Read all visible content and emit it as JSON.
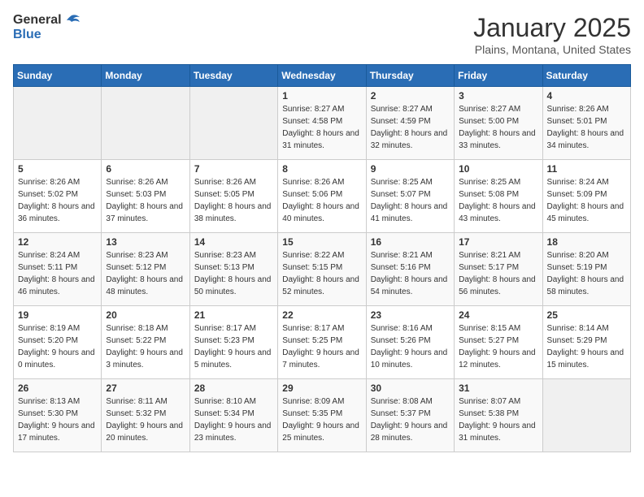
{
  "logo": {
    "general": "General",
    "blue": "Blue"
  },
  "header": {
    "month": "January 2025",
    "location": "Plains, Montana, United States"
  },
  "weekdays": [
    "Sunday",
    "Monday",
    "Tuesday",
    "Wednesday",
    "Thursday",
    "Friday",
    "Saturday"
  ],
  "weeks": [
    [
      {
        "day": "",
        "sunrise": "",
        "sunset": "",
        "daylight": ""
      },
      {
        "day": "",
        "sunrise": "",
        "sunset": "",
        "daylight": ""
      },
      {
        "day": "",
        "sunrise": "",
        "sunset": "",
        "daylight": ""
      },
      {
        "day": "1",
        "sunrise": "Sunrise: 8:27 AM",
        "sunset": "Sunset: 4:58 PM",
        "daylight": "Daylight: 8 hours and 31 minutes."
      },
      {
        "day": "2",
        "sunrise": "Sunrise: 8:27 AM",
        "sunset": "Sunset: 4:59 PM",
        "daylight": "Daylight: 8 hours and 32 minutes."
      },
      {
        "day": "3",
        "sunrise": "Sunrise: 8:27 AM",
        "sunset": "Sunset: 5:00 PM",
        "daylight": "Daylight: 8 hours and 33 minutes."
      },
      {
        "day": "4",
        "sunrise": "Sunrise: 8:26 AM",
        "sunset": "Sunset: 5:01 PM",
        "daylight": "Daylight: 8 hours and 34 minutes."
      }
    ],
    [
      {
        "day": "5",
        "sunrise": "Sunrise: 8:26 AM",
        "sunset": "Sunset: 5:02 PM",
        "daylight": "Daylight: 8 hours and 36 minutes."
      },
      {
        "day": "6",
        "sunrise": "Sunrise: 8:26 AM",
        "sunset": "Sunset: 5:03 PM",
        "daylight": "Daylight: 8 hours and 37 minutes."
      },
      {
        "day": "7",
        "sunrise": "Sunrise: 8:26 AM",
        "sunset": "Sunset: 5:05 PM",
        "daylight": "Daylight: 8 hours and 38 minutes."
      },
      {
        "day": "8",
        "sunrise": "Sunrise: 8:26 AM",
        "sunset": "Sunset: 5:06 PM",
        "daylight": "Daylight: 8 hours and 40 minutes."
      },
      {
        "day": "9",
        "sunrise": "Sunrise: 8:25 AM",
        "sunset": "Sunset: 5:07 PM",
        "daylight": "Daylight: 8 hours and 41 minutes."
      },
      {
        "day": "10",
        "sunrise": "Sunrise: 8:25 AM",
        "sunset": "Sunset: 5:08 PM",
        "daylight": "Daylight: 8 hours and 43 minutes."
      },
      {
        "day": "11",
        "sunrise": "Sunrise: 8:24 AM",
        "sunset": "Sunset: 5:09 PM",
        "daylight": "Daylight: 8 hours and 45 minutes."
      }
    ],
    [
      {
        "day": "12",
        "sunrise": "Sunrise: 8:24 AM",
        "sunset": "Sunset: 5:11 PM",
        "daylight": "Daylight: 8 hours and 46 minutes."
      },
      {
        "day": "13",
        "sunrise": "Sunrise: 8:23 AM",
        "sunset": "Sunset: 5:12 PM",
        "daylight": "Daylight: 8 hours and 48 minutes."
      },
      {
        "day": "14",
        "sunrise": "Sunrise: 8:23 AM",
        "sunset": "Sunset: 5:13 PM",
        "daylight": "Daylight: 8 hours and 50 minutes."
      },
      {
        "day": "15",
        "sunrise": "Sunrise: 8:22 AM",
        "sunset": "Sunset: 5:15 PM",
        "daylight": "Daylight: 8 hours and 52 minutes."
      },
      {
        "day": "16",
        "sunrise": "Sunrise: 8:21 AM",
        "sunset": "Sunset: 5:16 PM",
        "daylight": "Daylight: 8 hours and 54 minutes."
      },
      {
        "day": "17",
        "sunrise": "Sunrise: 8:21 AM",
        "sunset": "Sunset: 5:17 PM",
        "daylight": "Daylight: 8 hours and 56 minutes."
      },
      {
        "day": "18",
        "sunrise": "Sunrise: 8:20 AM",
        "sunset": "Sunset: 5:19 PM",
        "daylight": "Daylight: 8 hours and 58 minutes."
      }
    ],
    [
      {
        "day": "19",
        "sunrise": "Sunrise: 8:19 AM",
        "sunset": "Sunset: 5:20 PM",
        "daylight": "Daylight: 9 hours and 0 minutes."
      },
      {
        "day": "20",
        "sunrise": "Sunrise: 8:18 AM",
        "sunset": "Sunset: 5:22 PM",
        "daylight": "Daylight: 9 hours and 3 minutes."
      },
      {
        "day": "21",
        "sunrise": "Sunrise: 8:17 AM",
        "sunset": "Sunset: 5:23 PM",
        "daylight": "Daylight: 9 hours and 5 minutes."
      },
      {
        "day": "22",
        "sunrise": "Sunrise: 8:17 AM",
        "sunset": "Sunset: 5:25 PM",
        "daylight": "Daylight: 9 hours and 7 minutes."
      },
      {
        "day": "23",
        "sunrise": "Sunrise: 8:16 AM",
        "sunset": "Sunset: 5:26 PM",
        "daylight": "Daylight: 9 hours and 10 minutes."
      },
      {
        "day": "24",
        "sunrise": "Sunrise: 8:15 AM",
        "sunset": "Sunset: 5:27 PM",
        "daylight": "Daylight: 9 hours and 12 minutes."
      },
      {
        "day": "25",
        "sunrise": "Sunrise: 8:14 AM",
        "sunset": "Sunset: 5:29 PM",
        "daylight": "Daylight: 9 hours and 15 minutes."
      }
    ],
    [
      {
        "day": "26",
        "sunrise": "Sunrise: 8:13 AM",
        "sunset": "Sunset: 5:30 PM",
        "daylight": "Daylight: 9 hours and 17 minutes."
      },
      {
        "day": "27",
        "sunrise": "Sunrise: 8:11 AM",
        "sunset": "Sunset: 5:32 PM",
        "daylight": "Daylight: 9 hours and 20 minutes."
      },
      {
        "day": "28",
        "sunrise": "Sunrise: 8:10 AM",
        "sunset": "Sunset: 5:34 PM",
        "daylight": "Daylight: 9 hours and 23 minutes."
      },
      {
        "day": "29",
        "sunrise": "Sunrise: 8:09 AM",
        "sunset": "Sunset: 5:35 PM",
        "daylight": "Daylight: 9 hours and 25 minutes."
      },
      {
        "day": "30",
        "sunrise": "Sunrise: 8:08 AM",
        "sunset": "Sunset: 5:37 PM",
        "daylight": "Daylight: 9 hours and 28 minutes."
      },
      {
        "day": "31",
        "sunrise": "Sunrise: 8:07 AM",
        "sunset": "Sunset: 5:38 PM",
        "daylight": "Daylight: 9 hours and 31 minutes."
      },
      {
        "day": "",
        "sunrise": "",
        "sunset": "",
        "daylight": ""
      }
    ]
  ]
}
